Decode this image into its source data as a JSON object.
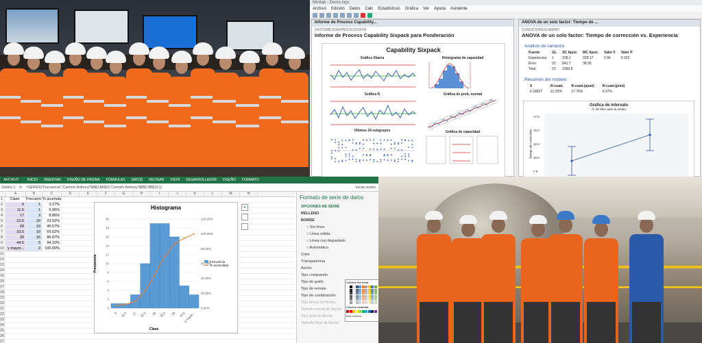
{
  "minitab": {
    "window_title": "Minitab - Demo.mpx",
    "menu": [
      "Archivo",
      "Edición",
      "Datos",
      "Calc",
      "Estadísticas",
      "Gráfica",
      "Ver",
      "Ayuda",
      "Asistente"
    ],
    "tab_left": "Informe de Process Capability...",
    "tab_right": "ANOVA de un solo factor: Tiempo de ...",
    "left_subtitle": "DATOSMEJORAPROCESOSFINI",
    "left_title": "Informe de Process Capability Sixpack para Ponderación",
    "sixpack_title": "Capability Sixpack",
    "chart_labels": {
      "xbar": "Gráfica Xbarra",
      "hist": "Histograma de capacidad",
      "r": "Gráfica R",
      "prob": "Gráfica de prob. normal",
      "last": "Últimos 24 subgrupos",
      "cap": "Gráfica de capacidad"
    },
    "right_subtitle": "CONDICIONESCAMINO",
    "right_title": "ANOVA de un solo factor: Tiempo de corrección vs. Experiencia",
    "anova_heading": "Análisis de varianza",
    "anova_table": {
      "headers": [
        "Fuente",
        "GL",
        "SC Ajust.",
        "MC Ajust.",
        "Valor F",
        "Valor P"
      ],
      "rows": [
        [
          "Experiencia",
          "1",
          "228.2",
          "228.17",
          "5.96",
          "0.023"
        ],
        [
          "Error",
          "22",
          "841.7",
          "38.26",
          "",
          ""
        ],
        [
          "Total",
          "23",
          "1069.8",
          "",
          "",
          ""
        ]
      ]
    },
    "model_heading": "Resumen del modelo",
    "model_table": {
      "headers": [
        "S",
        "R-cuad.",
        "R-cuad.(ajust)",
        "R-cuad.(pred)"
      ],
      "row": [
        "6.18527",
        "21.33%",
        "17.75%",
        "6.37%"
      ]
    },
    "interval_title": "Gráfica de intervalo",
    "interval_subtitle": "IC de 95% para la media",
    "interval_ylabel": "Tiempo de corrección",
    "interval_yticks": [
      "17.5",
      "15.0",
      "12.5",
      "10.0",
      "7.5"
    ]
  },
  "excel": {
    "tabs": [
      "ARCHIVO",
      "INICIO",
      "INSERTAR",
      "DISEÑO DE PÁGINA",
      "FÓRMULAS",
      "DATOS",
      "REVISAR",
      "VISTA",
      "DESARROLLADOR",
      "DISEÑO",
      "FORMATO"
    ],
    "signin": "Iniciar sesión",
    "namebox": "Gráfico 1",
    "formula": "=SERIES(\"Frecuencia\";'Carmelo Anthony'!$A$2:$A$10;'Carmelo Anthony'!$B$2:$B$10;1)",
    "columns": [
      "A",
      "B",
      "C",
      "D",
      "E",
      "F",
      "G",
      "H",
      "I",
      "J",
      "K",
      "L",
      "M",
      "N"
    ],
    "headers": [
      "Clase",
      "Frecuencia",
      "% acumulado"
    ],
    "rows": [
      [
        "6",
        "1",
        "3.27%"
      ],
      [
        "11.5",
        "1",
        "5.06%"
      ],
      [
        "17",
        "3",
        "8.86%"
      ],
      [
        "22.5",
        "10",
        "23.52%"
      ],
      [
        "28",
        "19",
        "45.57%"
      ],
      [
        "33.5",
        "19",
        "69.62%"
      ],
      [
        "39",
        "16",
        "86.87%"
      ],
      [
        "44.5",
        "5",
        "94.10%"
      ],
      [
        "y mayor...",
        "3",
        "100.00%"
      ]
    ],
    "chart_title": "Histograma",
    "chart_xlabel": "Clase",
    "chart_ylabel": "Frecuencia",
    "legend": [
      "Frecuencia",
      "% acumulado"
    ],
    "pane_title": "Formato de serie de datos",
    "pane_subtitle": "OPCIONES DE SERIE",
    "pane_sections": [
      "RELLENO",
      "BORDE"
    ],
    "pane_options": [
      "Sin línea",
      "Línea sólida",
      "Línea con degradado",
      "Automático"
    ],
    "pane_props": [
      "Color",
      "Transparencia",
      "Ancho",
      "Tipo compuesto",
      "Tipo de guión",
      "Tipo de remate",
      "Tipo de combinación",
      "Tipo inicial de flecha",
      "Tamaño inicial de flecha",
      "Tipo final de flecha",
      "Tamaño final de flecha"
    ],
    "color_popup_title": "Colores del tema",
    "color_popup_std": "Colores estándar",
    "color_popup_more": "Más colores..."
  },
  "chart_data": {
    "type": "bar",
    "categories": [
      "6",
      "11.5",
      "17",
      "22.5",
      "28",
      "33.5",
      "39",
      "44.5",
      "y mayor..."
    ],
    "series": [
      {
        "name": "Frecuencia",
        "values": [
          1,
          1,
          3,
          10,
          19,
          19,
          16,
          5,
          3
        ]
      },
      {
        "name": "% acumulado",
        "values": [
          3.27,
          5.06,
          8.86,
          23.52,
          45.57,
          69.62,
          86.87,
          94.1,
          100.0
        ]
      }
    ],
    "title": "Histograma",
    "xlabel": "Clase",
    "ylabel": "Frecuencia",
    "ylim": [
      0,
      20
    ],
    "y2lim": [
      0,
      120
    ]
  },
  "colors": {
    "excel_green": "#217346",
    "vest_orange": "#f06a1e",
    "bar_blue": "#5b9bd5",
    "line_orange": "#ed7d31"
  }
}
